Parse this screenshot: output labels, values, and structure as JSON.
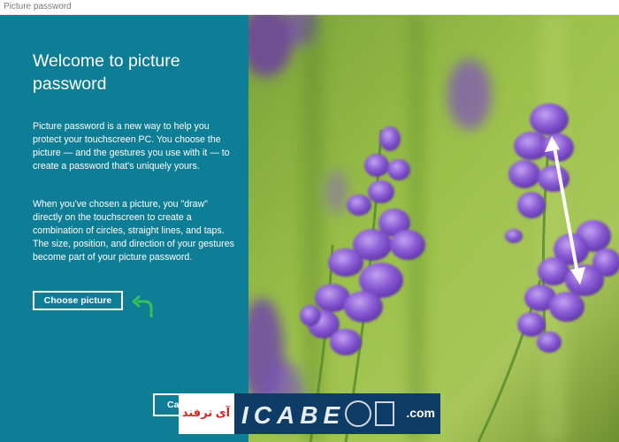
{
  "window": {
    "title": "Picture password"
  },
  "intro": {
    "heading": "Welcome to picture password",
    "paragraph1": "Picture password is a new way to help you protect your touchscreen PC. You choose the picture — and the gestures you use with it — to create a password that's uniquely yours.",
    "paragraph2": "When you've chosen a picture, you \"draw\" directly on the touchscreen to create a combination of circles, straight lines, and taps. The size, position, and direction of your gestures become part of your picture password."
  },
  "buttons": {
    "choose_picture": "Choose picture",
    "cancel": "Cancel"
  },
  "watermark": {
    "fa_text": "آی ترفند",
    "logo_text": "ICABE",
    "domain": ".com"
  },
  "colors": {
    "panel": "#0e7d96",
    "accent_arrow": "#34c15a",
    "watermark_bg": "#0d3d66"
  },
  "icons": [
    "return-arrow-icon",
    "gesture-arrow-icon"
  ]
}
